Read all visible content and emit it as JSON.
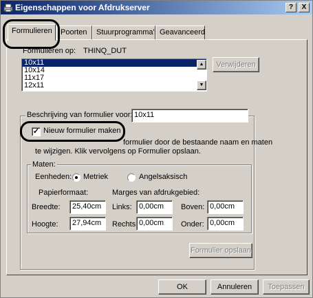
{
  "window": {
    "title": "Eigenschappen voor Afdrukserver",
    "help_btn": "?",
    "close_btn": "X"
  },
  "tabs": [
    {
      "label": "Formulieren",
      "active": true
    },
    {
      "label": "Poorten"
    },
    {
      "label": "Stuurprogramma's"
    },
    {
      "label": "Geavanceerd"
    }
  ],
  "forms": {
    "label": "Formulieren op:",
    "server": "THINQ_DUT",
    "list": [
      "10x11",
      "10x14",
      "11x17",
      "12x11"
    ],
    "selected": "10x11",
    "delete_button": "Verwijderen"
  },
  "description": {
    "label": "Beschrijving van formulier voor:",
    "value": "10x11"
  },
  "new_form": {
    "checkbox_label": "Nieuw formulier maken",
    "checked": true,
    "help_line1": "formulier door de bestaande naam en maten",
    "help_line2": "te wijzigen. Klik vervolgens op Formulier opslaan."
  },
  "measurements": {
    "group_label": "Maten:",
    "units_label": "Eenheden:",
    "unit_metric": "Metriek",
    "unit_english": "Angelsaksisch",
    "selected_unit": "Metriek",
    "paper_size_label": "Papierformaat:",
    "margins_label": "Marges van afdrukgebied:",
    "width_label": "Breedte:",
    "width_value": "25,40cm",
    "height_label": "Hoogte:",
    "height_value": "27,94cm",
    "left_label": "Links:",
    "left_value": "0,00cm",
    "right_label": "Rechts:",
    "right_value": "0,00cm",
    "top_label": "Boven:",
    "top_value": "0,00cm",
    "bottom_label": "Onder:",
    "bottom_value": "0,00cm",
    "save_button": "Formulier opslaan"
  },
  "dialog_buttons": {
    "ok": "OK",
    "cancel": "Annuleren",
    "apply": "Toepassen"
  },
  "colors": {
    "titlebar_start": "#0a246a",
    "titlebar_end": "#a6caf0",
    "face": "#d4d0c8",
    "selection": "#0a246a"
  }
}
